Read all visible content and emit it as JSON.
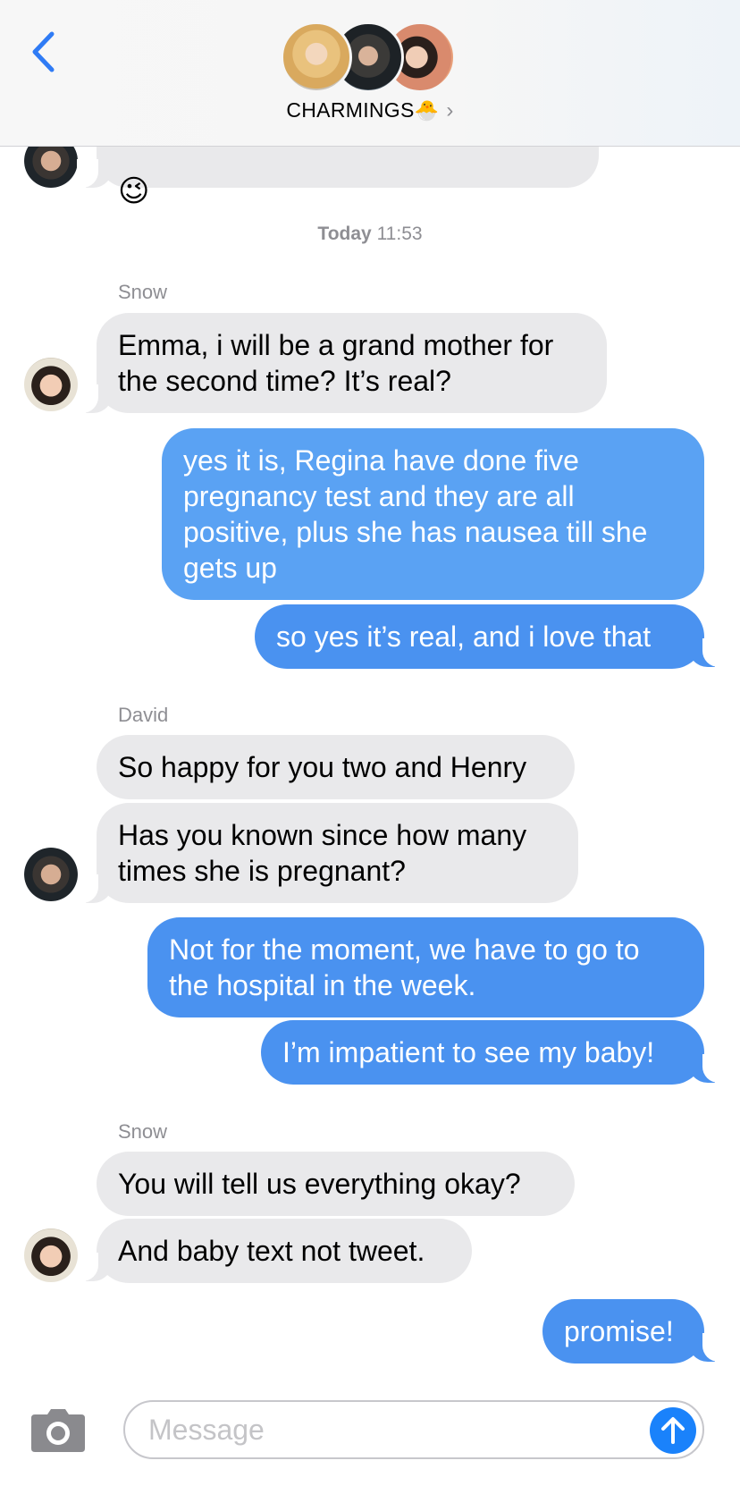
{
  "header": {
    "back_icon": "chevron-left-icon",
    "group_name": "CHARMINGS",
    "group_emoji": "🐣",
    "chevron": "›",
    "accent": "#2f7bf5"
  },
  "timestamp": {
    "day": "Today",
    "time": "11:53"
  },
  "top_bubble": {
    "emoji": "😉"
  },
  "messages": {
    "m1": {
      "sender": "Snow",
      "text": "Emma, i will be a grand mother for\nthe second time? It’s real?"
    },
    "m2": {
      "text": "yes it is, Regina have done five\npregnancy test and they are all\npositive, plus she has nausea till she\ngets up"
    },
    "m3": {
      "text": "so yes it’s real, and i love that"
    },
    "m4": {
      "sender": "David",
      "text": "So happy for you two and Henry"
    },
    "m5": {
      "text": "Has you known since how many\ntimes she is pregnant?"
    },
    "m6": {
      "text": "Not for the moment, we have to go to\nthe hospital in the week."
    },
    "m7": {
      "text": "I’m impatient to see my baby!"
    },
    "m8": {
      "sender": "Snow",
      "text": "You will tell us everything okay?"
    },
    "m9": {
      "text": "And baby text not tweet."
    },
    "m10": {
      "text": "promise!"
    }
  },
  "input": {
    "placeholder": "Message",
    "value": ""
  },
  "colors": {
    "incoming": "#e9e9eb",
    "outgoing": "#4a92f0",
    "send": "#1a82fb"
  }
}
